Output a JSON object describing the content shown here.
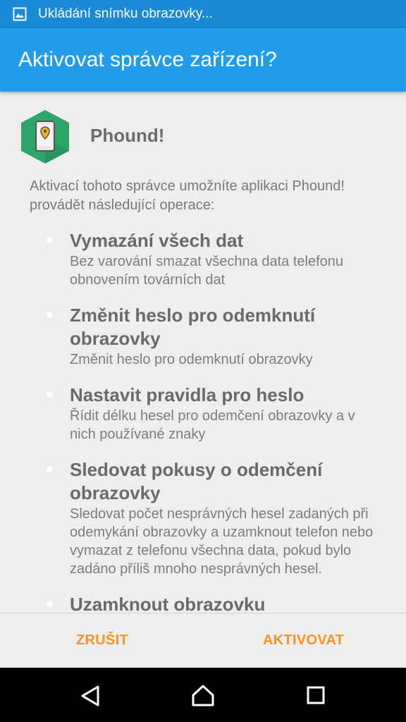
{
  "status_bar": {
    "notification": "Ukládání snímku obrazovky...",
    "icon": "image-icon"
  },
  "app_bar": {
    "title": "Aktivovat správce zařízení?"
  },
  "app": {
    "name": "Phound!",
    "icon": "phone-location-icon",
    "icon_color": "#2ea66a"
  },
  "intro": "Aktivací tohoto správce umožníte aplikaci Phound! provádět následující operace:",
  "permissions": [
    {
      "title": "Vymazání všech dat",
      "description": "Bez varování smazat všechna data telefonu obnovením továrních dat"
    },
    {
      "title": "Změnit heslo pro odemknutí obrazovky",
      "description": "Změnit heslo pro odemknutí obrazovky"
    },
    {
      "title": "Nastavit pravidla pro heslo",
      "description": "Řídit délku hesel pro odemčení obrazovky a v nich používané znaky"
    },
    {
      "title": "Sledovat pokusy o odemčení obrazovky",
      "description": "Sledovat počet nesprávných hesel zadaných při odemykání obrazovky a uzamknout telefon nebo vymazat z telefonu všechna data, pokud bylo zadáno příliš mnoho nesprávných hesel."
    },
    {
      "title": "Uzamknout obrazovku",
      "description": ""
    }
  ],
  "buttons": {
    "cancel": "ZRUŠIT",
    "activate": "AKTIVOVAT"
  },
  "colors": {
    "status_bar": "#1b8ad6",
    "app_bar": "#209ceb",
    "accent": "#f7931e",
    "background": "#eeeeee"
  },
  "nav": {
    "back": "back-icon",
    "home": "home-icon",
    "recents": "recents-icon"
  }
}
